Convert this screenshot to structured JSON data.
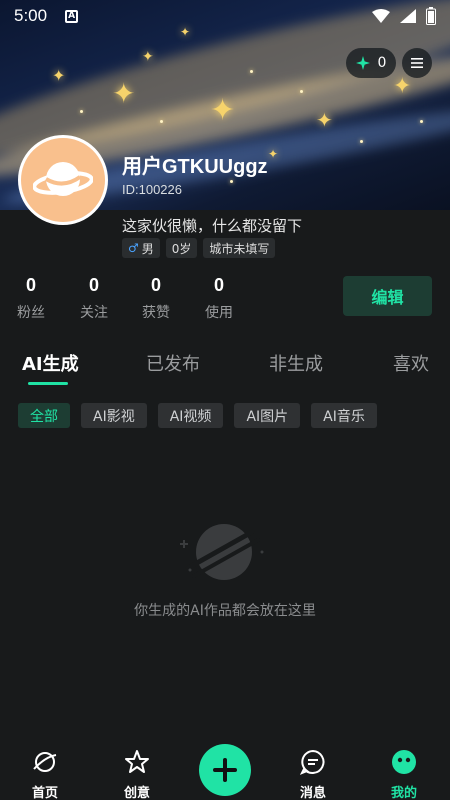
{
  "status_bar": {
    "time": "5:00",
    "notification_badge": "A"
  },
  "header": {
    "points_value": "0",
    "username": "用户GTKUUggz",
    "user_id": "ID:100226",
    "bio": "这家伙很懒，什么都没留下",
    "tags": {
      "gender": "男",
      "age": "0岁",
      "city": "城市未填写"
    }
  },
  "stats": [
    {
      "value": "0",
      "label": "粉丝"
    },
    {
      "value": "0",
      "label": "关注"
    },
    {
      "value": "0",
      "label": "获赞"
    },
    {
      "value": "0",
      "label": "使用"
    }
  ],
  "edit_label": "编辑",
  "tabs": [
    {
      "label": "AI生成",
      "active": true
    },
    {
      "label": "已发布"
    },
    {
      "label": "非生成"
    },
    {
      "label": "喜欢"
    }
  ],
  "chips": [
    {
      "label": "全部",
      "active": true
    },
    {
      "label": "AI影视"
    },
    {
      "label": "AI视频"
    },
    {
      "label": "AI图片"
    },
    {
      "label": "AI音乐"
    }
  ],
  "empty_state": {
    "text": "你生成的AI作品都会放在这里"
  },
  "bottom_nav": [
    {
      "label": "首页",
      "icon": "planet-icon"
    },
    {
      "label": "创意",
      "icon": "star-outline-icon"
    },
    {
      "label": "",
      "icon": "plus-icon"
    },
    {
      "label": "消息",
      "icon": "message-icon"
    },
    {
      "label": "我的",
      "icon": "profile-face-icon",
      "active": true
    }
  ],
  "colors": {
    "accent": "#20e3a5",
    "background": "#181a1b",
    "chip_bg": "#2f3133",
    "avatar_bg": "#f9c08d"
  }
}
